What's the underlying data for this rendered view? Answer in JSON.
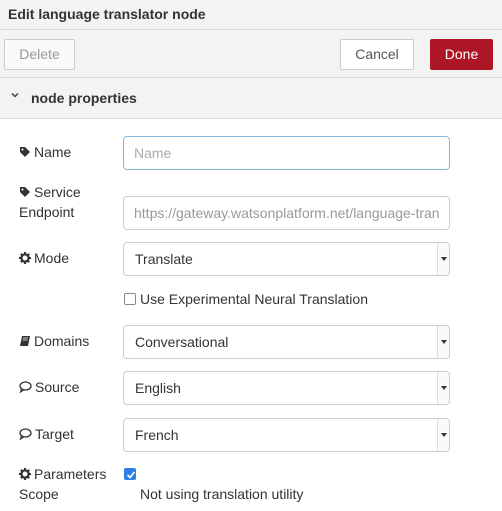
{
  "header": {
    "title": "Edit language translator node"
  },
  "toolbar": {
    "delete_label": "Delete",
    "cancel_label": "Cancel",
    "done_label": "Done"
  },
  "section": {
    "label": "node properties"
  },
  "form": {
    "name": {
      "label": "Name",
      "placeholder": "Name",
      "value": ""
    },
    "endpoint": {
      "label_line1": "Service",
      "label_line2": "Endpoint",
      "value": "https://gateway.watsonplatform.net/language-tran"
    },
    "mode": {
      "label": "Mode",
      "value": "Translate"
    },
    "neural": {
      "label": "Use Experimental Neural Translation",
      "checked": false
    },
    "domains": {
      "label": "Domains",
      "value": "Conversational"
    },
    "source": {
      "label": "Source",
      "value": "English"
    },
    "target": {
      "label": "Target",
      "value": "French"
    },
    "params": {
      "label_line1": "Parameters",
      "label_line2": "Scope",
      "checked": true,
      "note": "Not using translation utility"
    }
  },
  "colors": {
    "done": "#ad1625",
    "checkbox_on": "#2f7fe6",
    "focus_border": "#85b7d9"
  }
}
